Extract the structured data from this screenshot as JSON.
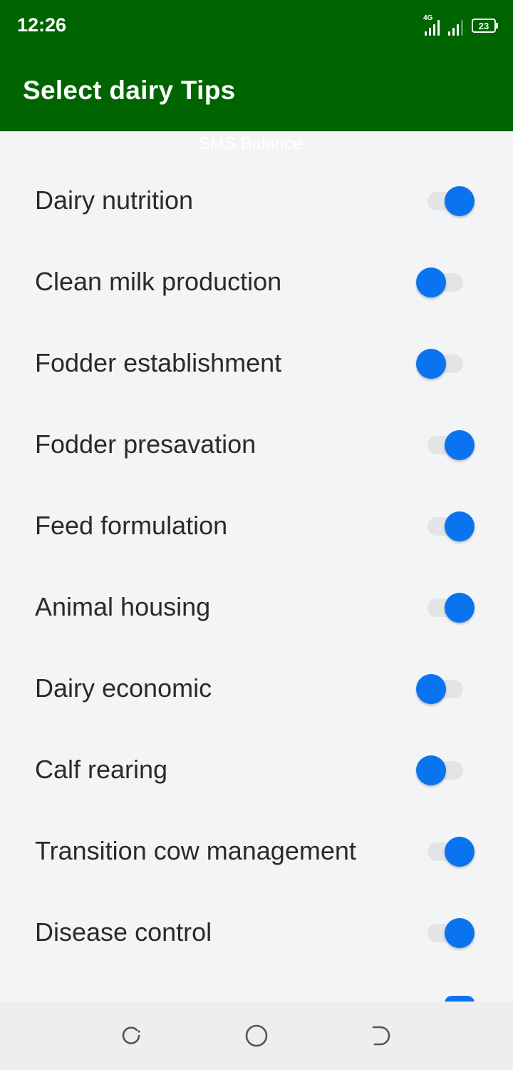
{
  "status_bar": {
    "time": "12:26",
    "network_type": "4G",
    "battery_level": "23",
    "icons": [
      "signal-icon",
      "signal-icon",
      "battery-icon"
    ]
  },
  "app_bar": {
    "title": "Select dairy Tips"
  },
  "sms_balance_label": "SMS Balance:",
  "tips": [
    {
      "label": "Dairy nutrition",
      "enabled": true
    },
    {
      "label": "Clean milk production",
      "enabled": false
    },
    {
      "label": "Fodder establishment",
      "enabled": false
    },
    {
      "label": "Fodder presavation",
      "enabled": true
    },
    {
      "label": "Feed formulation",
      "enabled": true
    },
    {
      "label": "Animal housing",
      "enabled": true
    },
    {
      "label": "Dairy economic",
      "enabled": false
    },
    {
      "label": "Calf rearing",
      "enabled": false
    },
    {
      "label": "Transition cow management",
      "enabled": true
    },
    {
      "label": "Disease control",
      "enabled": true
    }
  ],
  "nav_bar": {
    "buttons": [
      "recent-apps-icon",
      "home-icon",
      "back-icon"
    ]
  },
  "colors": {
    "header": "#006400",
    "switch_accent": "#0a73f0",
    "switch_track": "#e2e4e6",
    "background": "#f3f4f6"
  }
}
